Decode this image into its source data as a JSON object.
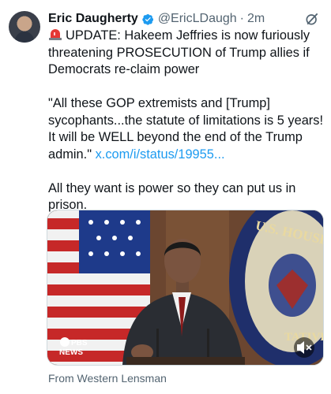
{
  "tweet": {
    "author_name": "Eric Daugherty",
    "handle": "@EricLDaugh",
    "separator": "·",
    "time": "2m",
    "para1": "UPDATE: Hakeem Jeffries is now furiously threatening PROSECUTION of Trump allies if Democrats re-claim power",
    "para2_text": "\"All these GOP extremists and [Trump] sycophants...the statute of limitations is 5 years! It will be WELL beyond the end of the Trump admin.\" ",
    "para2_link": "x.com/i/status/19955...",
    "para3": "All they want is power so they can put us in prison.",
    "icons": {
      "verified": "verified-badge-icon",
      "grok": "grok-icon",
      "siren": "siren-emoji-icon",
      "mute": "volume-muted-icon"
    }
  },
  "media": {
    "watermark_line1": "PBS",
    "watermark_line2": "NEWS",
    "seal_text": "U.S. HOUSE OF",
    "seal_text2": "TATIVE"
  },
  "source": {
    "label": "From Western Lensman"
  },
  "colors": {
    "accent": "#1d9bf0",
    "secondary_text": "#536471"
  }
}
